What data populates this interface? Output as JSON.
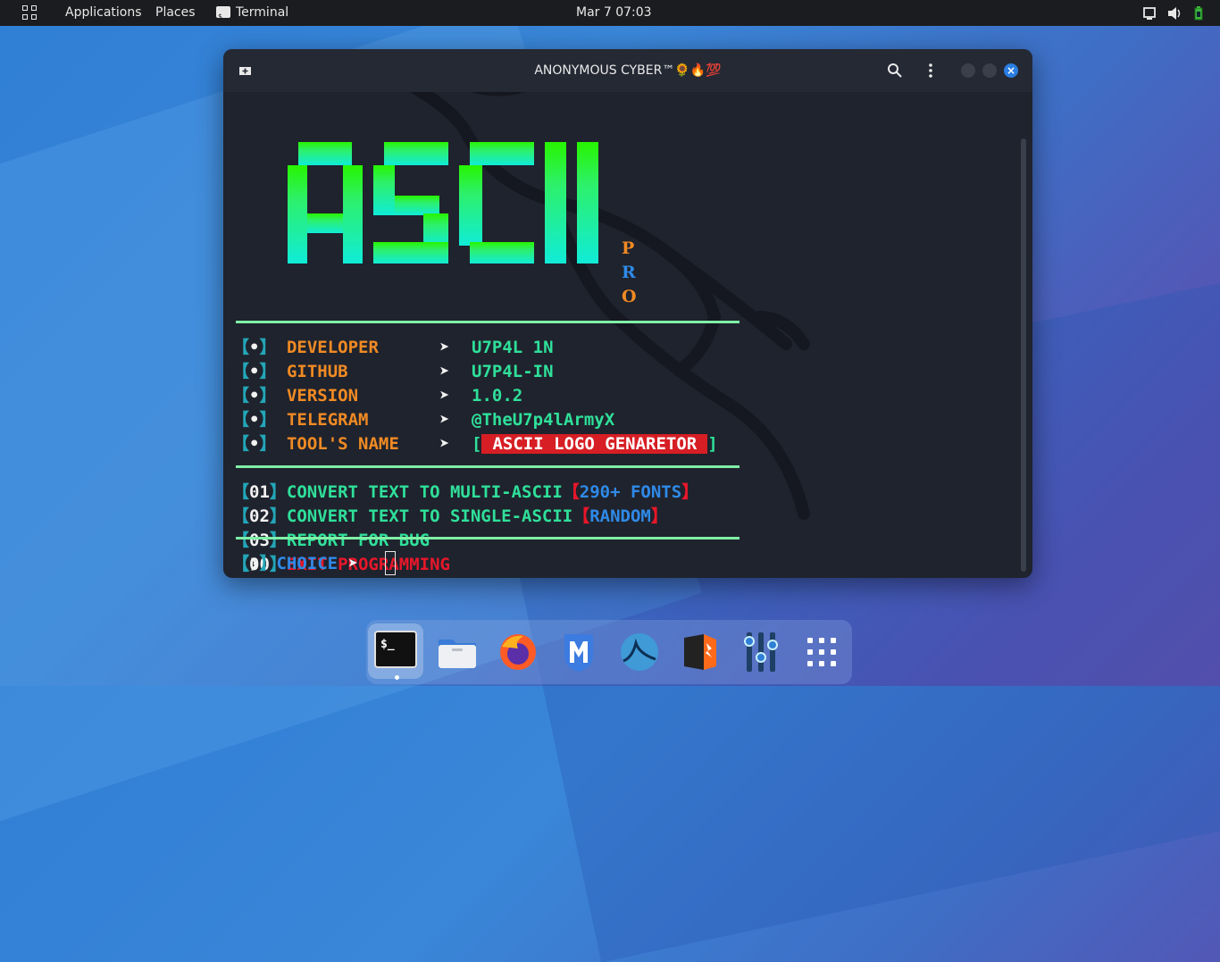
{
  "topbar": {
    "applications": "Applications",
    "places": "Places",
    "active_app": "Terminal",
    "clock": "Mar 7  07:03"
  },
  "window": {
    "title": "ANONYMOUS CYBER™🌻🔥💯"
  },
  "banner": {
    "big_text": "ASCII",
    "pro_letters": [
      "P",
      "R",
      "O"
    ]
  },
  "info": [
    {
      "bullet": "•",
      "key": "DEVELOPER",
      "arrow": "➤",
      "value": "U7P4L 1N"
    },
    {
      "bullet": "•",
      "key": "GITHUB",
      "arrow": "➤",
      "value": "U7P4L-IN"
    },
    {
      "bullet": "•",
      "key": "VERSION",
      "arrow": "➤",
      "value": "1.0.2"
    },
    {
      "bullet": "•",
      "key": "TELEGRAM",
      "arrow": "➤",
      "value": "@TheU7p4lArmyX"
    },
    {
      "bullet": "•",
      "key": "TOOL'S NAME",
      "arrow": "➤",
      "value": "ASCII LOGO GENARETOR"
    }
  ],
  "menu": [
    {
      "num": "01",
      "label": "CONVERT TEXT TO MULTI-ASCII",
      "tag": "290+ FONTS"
    },
    {
      "num": "02",
      "label": "CONVERT TEXT TO SINGLE-ASCII",
      "tag": "RANDOM"
    },
    {
      "num": "03",
      "label": "REPORT FOR BUG"
    },
    {
      "num": "00",
      "label": "EXIT PROGRAMMING"
    }
  ],
  "prompt": {
    "marker": "❯",
    "label": "CHOICE",
    "arrow": "➤"
  },
  "dock": {
    "items": [
      "terminal-icon",
      "files-icon",
      "firefox-icon",
      "metasploit-icon",
      "wireshark-icon",
      "burpsuite-icon",
      "settings-mixer-icon",
      "app-grid-icon"
    ]
  },
  "colors": {
    "accent_orange": "#f08a24",
    "accent_green": "#2fe09a",
    "bracket_teal": "#23a6b8",
    "exit_red": "#e8172a",
    "highlight_red": "#d61e24",
    "link_blue": "#2f8ae8"
  }
}
